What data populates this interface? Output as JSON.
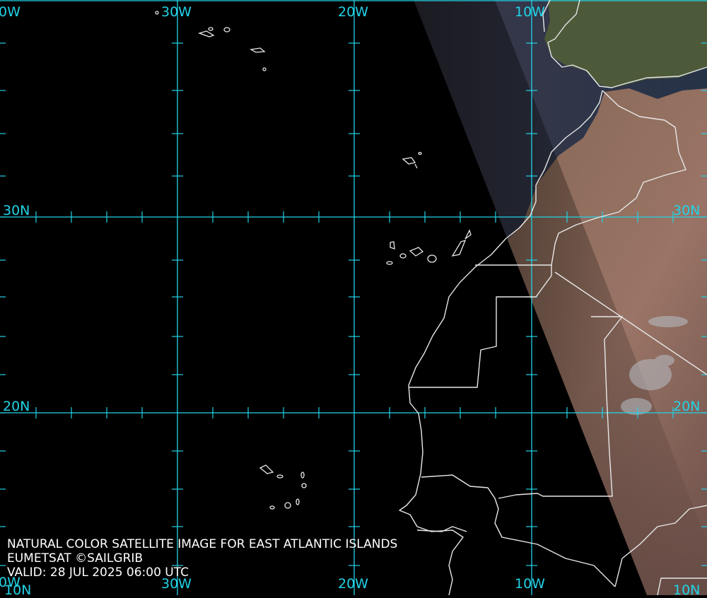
{
  "map": {
    "longitude_labels": [
      "30W",
      "20W",
      "10W"
    ],
    "latitude_labels": [
      "30N",
      "20N"
    ],
    "edge_labels": {
      "top_left_clipped": "0W",
      "bottom_left_clipped": "0W",
      "bottom_left_lat": "10N",
      "bottom_right_lat": "10N"
    },
    "colors": {
      "graticule": "#22d3e6",
      "coastline": "#e8e8e8",
      "night_side": "#000000",
      "ocean_day": "#27344a",
      "land_day": "#8a6a5a",
      "vegetation": "#4c5d38"
    }
  },
  "caption": {
    "line1": "NATURAL COLOR SATELLITE IMAGE FOR EAST ATLANTIC ISLANDS",
    "line2": "EUMETSAT ©SAILGRIB",
    "line3": "VALID:  28 JUL 2025 06:00 UTC"
  }
}
